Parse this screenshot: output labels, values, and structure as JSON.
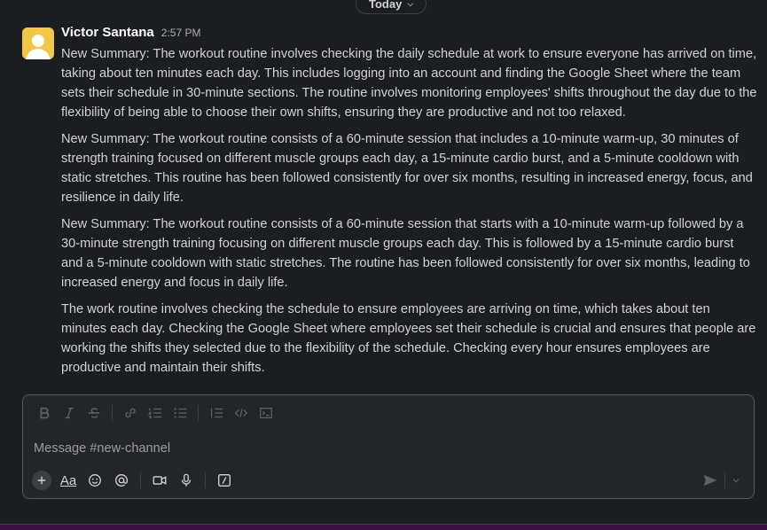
{
  "date_divider": {
    "label": "Today"
  },
  "message": {
    "sender": "Victor Santana",
    "timestamp": "2:57 PM",
    "paragraphs": [
      "New Summary: The workout routine involves checking the daily schedule at work to ensure everyone has arrived on time, taking about ten minutes each day. This includes logging into an account and finding the Google Sheet where the team sets their schedule in 30-minute sections. The routine involves monitoring employees' shifts throughout the day due to the flexibility of being able to choose their own shifts, ensuring they are productive and not too relaxed.",
      "New Summary: The workout routine consists of a 60-minute session that includes a 10-minute warm-up, 30 minutes of strength training focused on different muscle groups each day, a 15-minute cardio burst, and a 5-minute cooldown with static stretches. This routine has been followed consistently for over six months, resulting in increased energy, focus, and resilience in daily life.",
      "New Summary: The workout routine consists of a 60-minute session that starts with a 10-minute warm-up followed by a 30-minute strength training focusing on different muscle groups each day. This is followed by a 15-minute cardio burst and a 5-minute cooldown with static stretches. The routine has been followed consistently for over six months, leading to increased energy and focus in daily life.",
      "The work routine involves checking the schedule to ensure employees are arriving on time, which takes about ten minutes each day. Checking the Google Sheet where employees set their schedule is crucial and ensures that people are working the shifts they selected due to the flexibility of the schedule. Checking every hour ensures employees are productive and maintain their shifts."
    ]
  },
  "composer": {
    "placeholder": "Message #new-channel",
    "value": "",
    "format_label": "Aa",
    "toolbar_icons": [
      "bold-icon",
      "italic-icon",
      "strikethrough-icon",
      "link-icon",
      "ordered-list-icon",
      "bulleted-list-icon",
      "blockquote-icon",
      "code-icon",
      "code-block-icon"
    ],
    "bottom_icons": [
      "plus-icon",
      "format-icon",
      "emoji-icon",
      "mention-icon",
      "video-icon",
      "microphone-icon",
      "slash-command-icon"
    ],
    "send_icons": [
      "send-icon",
      "chevron-down-icon"
    ]
  },
  "colors": {
    "background": "#1a1d21",
    "composer_bg": "#222529",
    "avatar": "#f2c744",
    "bottom_bar": "#3f0e40"
  }
}
